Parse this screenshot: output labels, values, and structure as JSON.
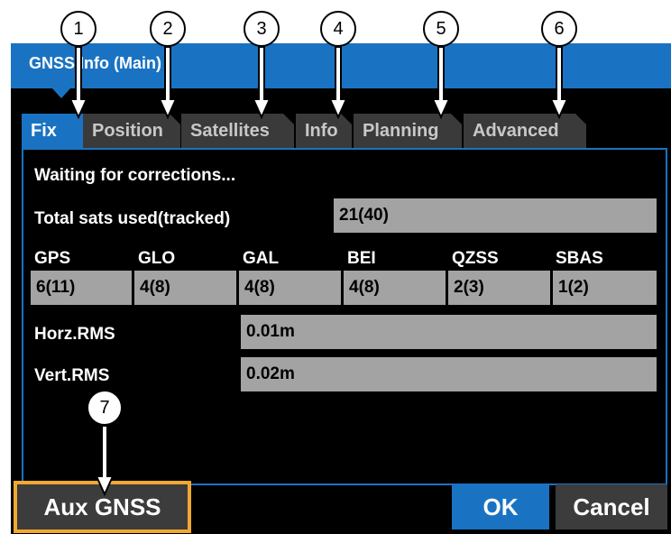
{
  "window": {
    "title": "GNSS Info (Main)"
  },
  "tabs": [
    {
      "label": "Fix",
      "active": true
    },
    {
      "label": "Position",
      "active": false
    },
    {
      "label": "Satellites",
      "active": false
    },
    {
      "label": "Info",
      "active": false
    },
    {
      "label": "Planning",
      "active": false
    },
    {
      "label": "Advanced",
      "active": false
    }
  ],
  "fix": {
    "status": "Waiting for corrections...",
    "total_label": "Total sats used(tracked)",
    "total_value": "21(40)",
    "constellations": [
      {
        "name": "GPS",
        "value": "6(11)"
      },
      {
        "name": "GLO",
        "value": "4(8)"
      },
      {
        "name": "GAL",
        "value": "4(8)"
      },
      {
        "name": "BEI",
        "value": "4(8)"
      },
      {
        "name": "QZSS",
        "value": "2(3)"
      },
      {
        "name": "SBAS",
        "value": "1(2)"
      }
    ],
    "horz_label": "Horz.RMS",
    "horz_value": "0.01m",
    "vert_label": "Vert.RMS",
    "vert_value": "0.02m"
  },
  "buttons": {
    "aux": "Aux GNSS",
    "ok": "OK",
    "cancel": "Cancel"
  },
  "callouts": [
    "1",
    "2",
    "3",
    "4",
    "5",
    "6",
    "7"
  ],
  "colors": {
    "accent": "#1a73c2",
    "highlight": "#f0a830",
    "value_box": "#a3a3a3"
  }
}
